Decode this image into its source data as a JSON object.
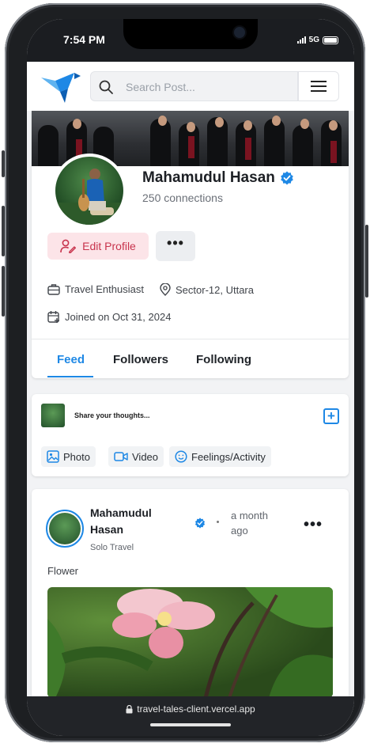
{
  "status_bar": {
    "time": "7:54 PM",
    "network": "5G"
  },
  "navbar": {
    "search_placeholder": "Search Post...",
    "logo_icon": "bird-logo-icon",
    "menu_icon": "hamburger-icon"
  },
  "profile": {
    "name": "Mahamudul Hasan",
    "connections": "250 connections",
    "edit_label": "Edit Profile",
    "more_label": "•••",
    "bio": "Travel Enthusiast",
    "location": "Sector-12, Uttara",
    "joined": "Joined on Oct 31, 2024",
    "tabs": [
      {
        "label": "Feed",
        "active": true
      },
      {
        "label": "Followers",
        "active": false
      },
      {
        "label": "Following",
        "active": false
      }
    ]
  },
  "composer": {
    "placeholder": "Share your thoughts...",
    "actions": [
      {
        "label": "Photo",
        "icon": "image-icon"
      },
      {
        "label": "Video",
        "icon": "video-icon"
      },
      {
        "label": "Feelings/Activity",
        "icon": "smile-icon"
      }
    ]
  },
  "post": {
    "author": "Mahamudul Hasan",
    "category": "Solo Travel",
    "time": "a month ago",
    "more_label": "•••",
    "caption": "Flower"
  },
  "browser": {
    "url": "travel-tales-client.vercel.app"
  },
  "colors": {
    "accent": "#1e88e5",
    "danger": "#c8344d",
    "danger_bg": "#fce4e8"
  }
}
